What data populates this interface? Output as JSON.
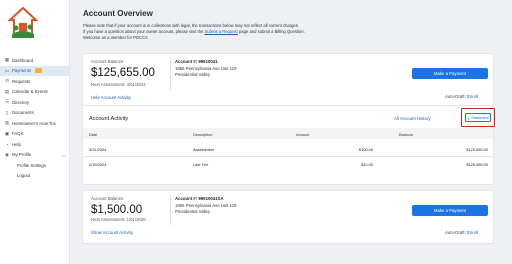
{
  "sidebar": {
    "items": [
      {
        "label": "Dashboard",
        "icon": "grid-icon",
        "glyph": "▦"
      },
      {
        "label": "Payments",
        "icon": "card-icon",
        "glyph": "▭",
        "active": true
      },
      {
        "label": "Requests",
        "icon": "request-icon",
        "glyph": "⟲"
      },
      {
        "label": "Calendar & Events",
        "icon": "calendar-icon",
        "glyph": "▤"
      },
      {
        "label": "Directory",
        "icon": "directory-icon",
        "glyph": "☰"
      },
      {
        "label": "Documents",
        "icon": "document-icon",
        "glyph": "▯"
      },
      {
        "label": "Homeowner's How Tos",
        "icon": "book-icon",
        "glyph": "▥"
      },
      {
        "label": "FAQs",
        "icon": "faq-icon",
        "glyph": "▣"
      },
      {
        "label": "Help",
        "icon": "help-icon",
        "glyph": "◔"
      },
      {
        "label": "My Profile",
        "icon": "user-icon",
        "glyph": "◉"
      }
    ],
    "profile_sub": [
      "Profile Settings",
      "Logout"
    ]
  },
  "page": {
    "title": "Account Overview",
    "notice_line1": "Please note that if your account is in collections with legal, the transactions below may not reflect all current charges.",
    "notice_line2a": "If you have a question about your owner account, please visit the ",
    "notice_link": "Submit a Request",
    "notice_line2b": " page and submit a Billing Question.",
    "notice_line3": "Welcome as a member for PDCCA"
  },
  "account1": {
    "balance_label": "Account Balance:",
    "balance": "$125,655.00",
    "next_assessment": "Next Assessment: 4/01/2024",
    "account_number": "Account #: 99910041",
    "address_line1": "1955 Pennsylvania Ave Unit 119",
    "address_line2": "Presidential Valley",
    "make_payment": "Make a Payment",
    "autodraft_label": "Auto-Draft:",
    "autodraft_link": "Enroll",
    "toggle_activity": "Hide Account Activity",
    "activity_title": "Account Activity",
    "history_link": "All Account History",
    "statement_button": "Statement",
    "columns": [
      "Date",
      "Description",
      "Amount",
      "Balance"
    ],
    "rows": [
      [
        "5/31/2024",
        "Assessment",
        "$100.00",
        "$125,655.00"
      ],
      [
        "2/15/2024",
        "Late Fee",
        "$10.00",
        "$125,555.00"
      ]
    ]
  },
  "account2": {
    "balance_label": "Account Balance:",
    "balance": "$1,500.00",
    "next_assessment": "Next Assessment: 1/01/2026",
    "account_number": "Account #: 99910041SA",
    "address_line1": "1955 Pennsylvania Ave Unit 119",
    "address_line2": "Presidential Valley",
    "make_payment": "Make a Payment",
    "autodraft_label": "Auto-Draft:",
    "autodraft_link": "Enroll",
    "toggle_activity": "Show Account Activity"
  }
}
